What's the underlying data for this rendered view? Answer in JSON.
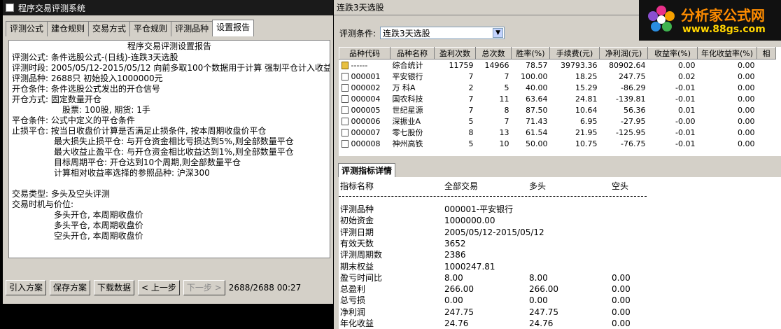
{
  "left_window": {
    "title": "程序交易评测系统",
    "tabs": [
      "评测公式",
      "建仓规则",
      "交易方式",
      "平仓规则",
      "评测品种",
      "设置报告"
    ],
    "report_title": "程序交易评测设置报告",
    "lines": [
      "评测公式: 条件选股公式-(日线)-连跌3天选股",
      "评测时段: 2005/05/12-2015/05/12 向前多取100个数据用于计算 强制平仓计入收益",
      "评测品种: 2688只 初始投入1000000元",
      "开仓条件: 条件选股公式发出的开仓信号",
      "开仓方式: 固定数量开仓",
      "股票: 100股, 期货: 1手",
      "平仓条件: 公式中定义的平仓条件",
      "止损平仓: 按当日收盘价计算是否满足止损条件, 按本周期收盘价平仓",
      "最大损失止损平仓: 与开仓资金相比亏损达到5%,则全部数量平仓",
      "最大收益止盈平仓: 与开仓资金相比收益达到1%,则全部数量平仓",
      "目标周期平仓: 开仓达到10个周期,则全部数量平仓",
      "计算相对收益率选择的参照品种: 沪深300",
      "交易类型: 多头及空头评测",
      "交易时机与价位:",
      "多头开仓, 本周期收盘价",
      "多头平仓, 本周期收盘价",
      "空头开仓, 本周期收盘价"
    ],
    "buttons": [
      "引入方案",
      "保存方案",
      "下载数据",
      "< 上一步",
      "下一步 >"
    ],
    "status": "2688/2688 00:27"
  },
  "right_window": {
    "title": "连跌3天选股",
    "filter_label": "评测条件:",
    "filter_value": "连跌3天选股",
    "columns": [
      "品种代码",
      "品种名称",
      "盈利次数",
      "总次数",
      "胜率(%)",
      "手续费(元)",
      "净利润(元)",
      "收益率(%)",
      "年化收益率(%)",
      "相"
    ],
    "rows": [
      [
        "------",
        "综合统计",
        "11759",
        "14966",
        "78.57",
        "39793.36",
        "80902.64",
        "0.00",
        "0.00"
      ],
      [
        "000001",
        "平安银行",
        "7",
        "7",
        "100.00",
        "18.25",
        "247.75",
        "0.02",
        "0.00"
      ],
      [
        "000002",
        "万 科A",
        "2",
        "5",
        "40.00",
        "15.29",
        "-86.29",
        "-0.01",
        "0.00"
      ],
      [
        "000004",
        "国农科技",
        "7",
        "11",
        "63.64",
        "24.81",
        "-139.81",
        "-0.01",
        "0.00"
      ],
      [
        "000005",
        "世纪星源",
        "7",
        "8",
        "87.50",
        "10.64",
        "56.36",
        "0.01",
        "0.00"
      ],
      [
        "000006",
        "深振业A",
        "5",
        "7",
        "71.43",
        "6.95",
        "-27.95",
        "-0.00",
        "0.00"
      ],
      [
        "000007",
        "零七股份",
        "8",
        "13",
        "61.54",
        "21.95",
        "-125.95",
        "-0.01",
        "0.00"
      ],
      [
        "000008",
        "神州高铁",
        "5",
        "10",
        "50.00",
        "10.75",
        "-76.75",
        "-0.01",
        "0.00"
      ]
    ],
    "detail_tab": "评测指标详情",
    "detail_headers": [
      "指标名称",
      "全部交易",
      "多头",
      "空头"
    ],
    "detail_rows": [
      [
        "评测品种",
        "000001-平安银行",
        "",
        ""
      ],
      [
        "初始资金",
        "1000000.00",
        "",
        ""
      ],
      [
        "评测日期",
        "2005/05/12-2015/05/12",
        "",
        ""
      ],
      [
        "有效天数",
        "3652",
        "",
        ""
      ],
      [
        "评测周期数",
        "2386",
        "",
        ""
      ],
      [
        "期末权益",
        "1000247.81",
        "",
        ""
      ],
      [
        "盈亏时间比",
        "8.00",
        "8.00",
        "0.00"
      ],
      [
        "总盈利",
        "266.00",
        "266.00",
        "0.00"
      ],
      [
        "总亏损",
        "0.00",
        "0.00",
        "0.00"
      ],
      [
        "净利润",
        "247.75",
        "247.75",
        "0.00"
      ],
      [
        "年化收益",
        "24.76",
        "24.76",
        "0.00"
      ]
    ]
  },
  "logo": {
    "main": "分析家公式网",
    "url": "www.88gs.com"
  }
}
